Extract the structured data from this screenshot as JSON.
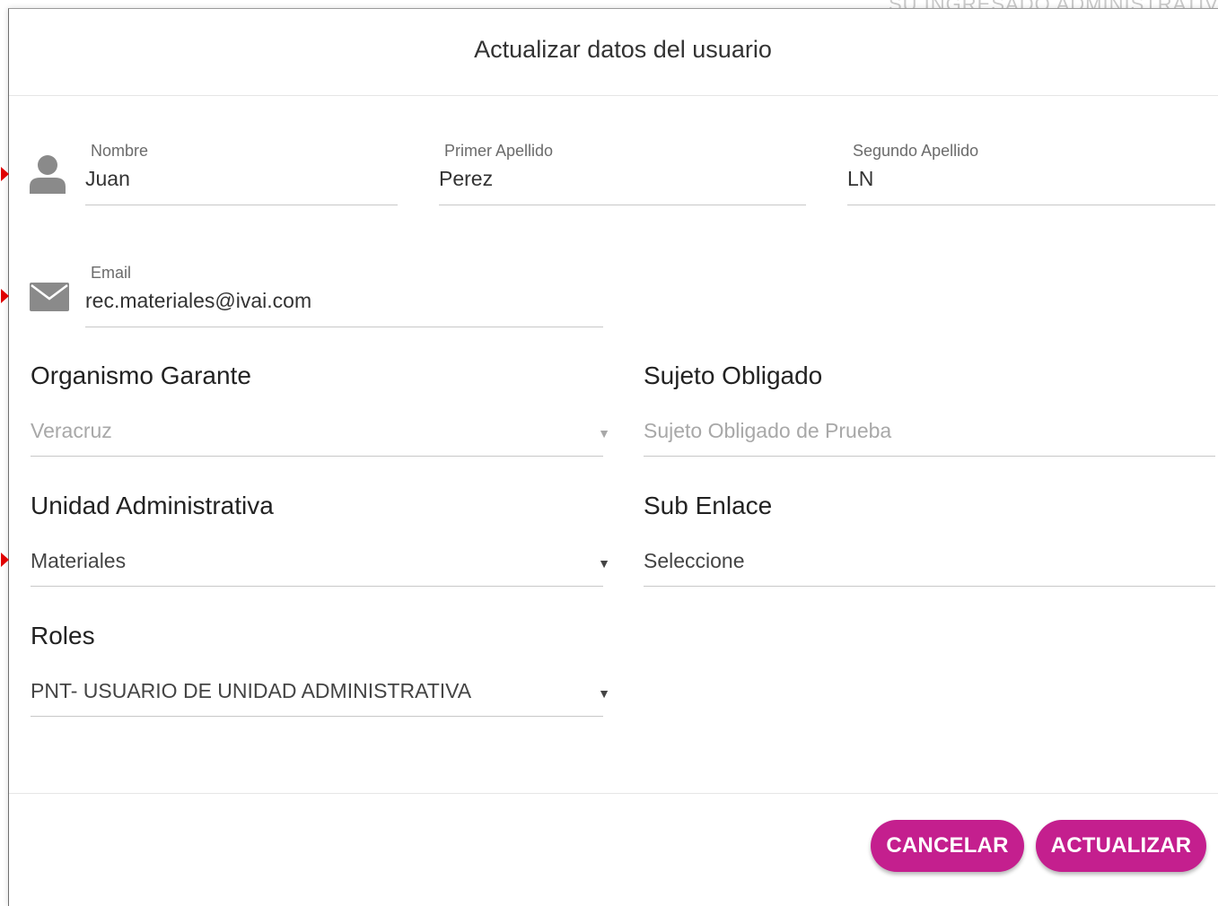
{
  "backdrop": {
    "text": "SU INGRESADO ADMINISTRATIVO"
  },
  "dialog": {
    "title": "Actualizar datos del usuario"
  },
  "fields": {
    "nombre": {
      "label": "Nombre",
      "value": "Juan",
      "icon": "user-icon"
    },
    "primer_apellido": {
      "label": "Primer Apellido",
      "value": "Perez"
    },
    "segundo_apellido": {
      "label": "Segundo Apellido",
      "value": "LN"
    },
    "email": {
      "label": "Email",
      "value": "rec.materiales@ivai.com",
      "icon": "envelope-icon"
    }
  },
  "selects": {
    "organismo_garante": {
      "heading": "Organismo Garante",
      "value": "Veracruz",
      "disabled": true
    },
    "sujeto_obligado": {
      "heading": "Sujeto Obligado",
      "value": "Sujeto Obligado de Prueba",
      "disabled": true
    },
    "unidad_administrativa": {
      "heading": "Unidad Administrativa",
      "value": "Materiales"
    },
    "sub_enlace": {
      "heading": "Sub Enlace",
      "value": "Seleccione"
    },
    "roles": {
      "heading": "Roles",
      "value": "PNT- USUARIO DE UNIDAD ADMINISTRATIVA"
    }
  },
  "caret": "▼",
  "buttons": {
    "cancel": "CANCELAR",
    "update": "ACTUALIZAR"
  },
  "colors": {
    "accent": "#c41f8e",
    "annotation_arrow": "#e00000",
    "icon_gray": "#8a8a8a"
  }
}
